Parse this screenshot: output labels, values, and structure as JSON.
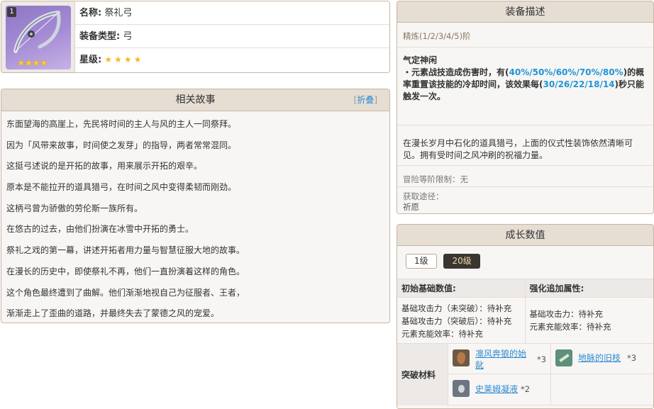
{
  "info": {
    "level_badge": "1",
    "thumb_stars": "★★★★",
    "name_label": "名称:",
    "name_value": "祭礼弓",
    "type_label": "装备类型:",
    "type_value": "弓",
    "rarity_label": "星级:",
    "rarity_stars": "★★★★"
  },
  "story": {
    "title": "相关故事",
    "fold_open": "[",
    "fold_label": "折叠",
    "fold_close": "]",
    "lines": [
      "东面望海的高崖上，先民将时间的主人与风的主人一同祭拜。",
      "因为「风带来故事，时间使之发芽」的指导，两者常常混同。",
      "这挺弓述说的是开拓的故事，用来展示开拓的艰辛。",
      "原本是不能拉开的道具猎弓，在时间之风中变得柔韧而刚劲。",
      "这柄弓曾为骄傲的劳伦斯一族所有。",
      "在悠古的过去，由他们扮演在冰雪中开拓的勇士。",
      "祭礼之戏的第一幕，讲述开拓者用力量与智慧征服大地的故事。",
      "在漫长的历史中，即使祭礼不再，他们一直扮演着这样的角色。",
      "这个角色最终遭到了曲解。他们渐渐地视自己为征服者、王者，",
      "渐渐走上了歪曲的道路，并最终失去了蒙德之风的宠爱。"
    ]
  },
  "desc": {
    "title": "装备描述",
    "refine": "精炼(1/2/3/4/5)阶",
    "effect_title": "气定神闲",
    "effect_p1": "・元素战技造成伤害时，有(",
    "effect_hl1": "40%/50%/60%/70%/80%",
    "effect_p2": ")的概率重置该技能的冷却时间，该效果每(",
    "effect_hl2": "30/26/22/18/14",
    "effect_p3": ")秒只能触发一次。",
    "flavor": "在漫长岁月中石化的道具猎弓，上面的仪式性装饰依然清晰可见。拥有受时间之风冲刷的祝福力量。",
    "adventure_rank": "冒险等阶限制：无",
    "obtain_label": "获取途径：",
    "obtain_value": "祈愿"
  },
  "growth": {
    "title": "成长数值",
    "levels": [
      "1级",
      "20级"
    ],
    "active_level": "20级",
    "base_title": "初始基础数值:",
    "base_lines": [
      "基础攻击力（未突破）：待补充",
      "基础攻击力（突破后）：待补充",
      "元素充能效率：待补充"
    ],
    "bonus_title": "强化追加属性:",
    "bonus_lines": [
      "基础攻击力：待补充",
      "元素充能效率：待补充"
    ],
    "materials_label": "突破材料",
    "materials": [
      {
        "name": "凛风奔狼的始龀",
        "count": "*3",
        "icon": "wolf-tooth-icon"
      },
      {
        "name": "地脉的旧枝",
        "count": "*3",
        "icon": "ley-line-branch-icon"
      },
      {
        "name": "史莱姆凝液",
        "count": "*2",
        "icon": "slime-condensate-icon"
      }
    ]
  }
}
